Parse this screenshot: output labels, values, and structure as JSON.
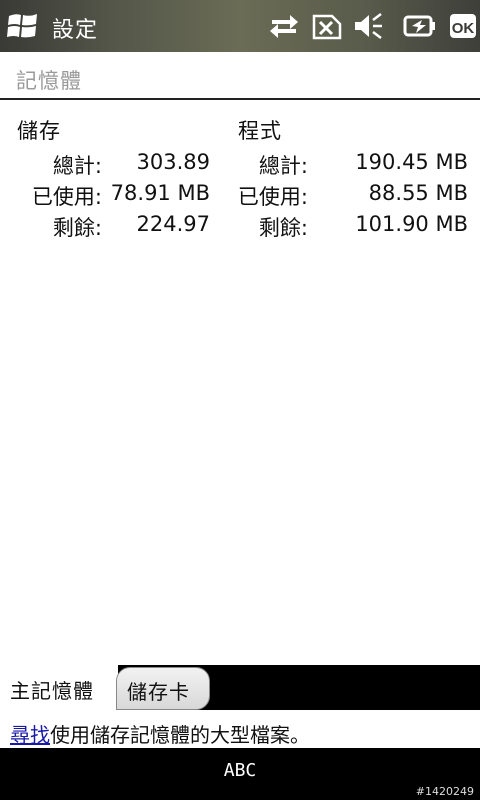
{
  "titlebar": {
    "title": "設定",
    "icons": [
      "windows-start-icon",
      "data-transfer-icon",
      "no-sim-icon",
      "speaker-muted-icon",
      "battery-charging-icon",
      "ok-icon"
    ],
    "ok_label": "OK"
  },
  "section": {
    "title": "記憶體"
  },
  "storage": {
    "heading": "儲存",
    "total_label": "總計:",
    "total_value": "303.89",
    "used_label": "已使用:",
    "used_value": "78.91 MB",
    "free_label": "剩餘:",
    "free_value": "224.97"
  },
  "program": {
    "heading": "程式",
    "total_label": "總計:",
    "total_value": "190.45 MB",
    "used_label": "已使用:",
    "used_value": "88.55 MB",
    "free_label": "剩餘:",
    "free_value": "101.90 MB"
  },
  "tabs": [
    {
      "label": "主記憶體",
      "active": true
    },
    {
      "label": "儲存卡",
      "active": false
    }
  ],
  "info": {
    "link_text": "尋找",
    "rest_text": "使用儲存記憶體的大型檔案。"
  },
  "softkeys": {
    "sip_label": "ABC"
  },
  "watermark": "#1420249"
}
